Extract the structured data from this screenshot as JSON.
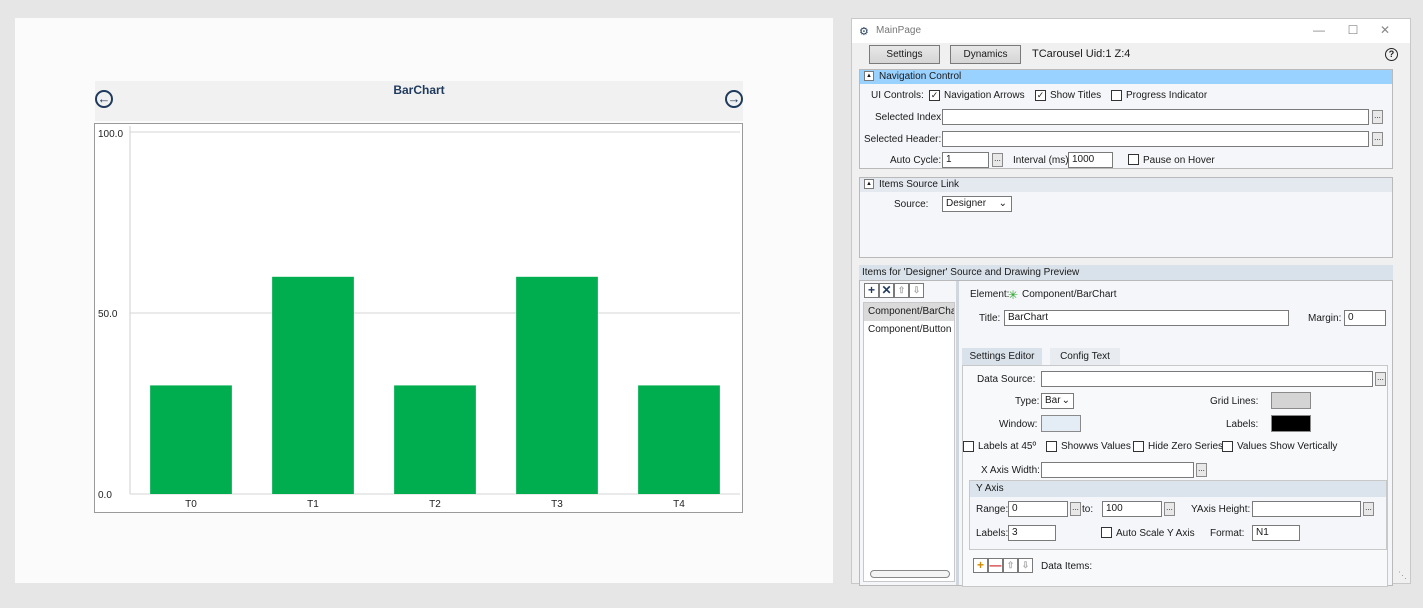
{
  "canvas": {
    "carousel_title": "BarChart",
    "prev_icon": "circle-arrow-left-icon",
    "next_icon": "circle-arrow-right-icon"
  },
  "chart_data": {
    "type": "bar",
    "categories": [
      "T0",
      "T1",
      "T2",
      "T3",
      "T4"
    ],
    "values": [
      30,
      60,
      30,
      60,
      30
    ],
    "ylim": [
      0,
      100
    ],
    "yticks": [
      "0.0",
      "50.0",
      "100.0"
    ],
    "grid": true,
    "bar_color": "#00ae4f",
    "title": "",
    "xlabel": "",
    "ylabel": ""
  },
  "window": {
    "title": "MainPage",
    "app_icon": "gear-icon",
    "minimize": "—",
    "maximize": "☐",
    "close": "✕",
    "tabs": [
      "Settings",
      "Dynamics"
    ],
    "component_info": "TCarousel Uid:1 Z:4",
    "help": "?"
  },
  "nav_control": {
    "header": "Navigation Control",
    "ui_controls_label": "UI Controls:",
    "nav_arrows_label": "Navigation Arrows",
    "nav_arrows_checked": true,
    "show_titles_label": "Show Titles",
    "show_titles_checked": true,
    "progress_label": "Progress Indicator",
    "progress_checked": false,
    "selected_index_label": "Selected Index:",
    "selected_index_value": "",
    "selected_header_label": "Selected Header:",
    "selected_header_value": "",
    "auto_cycle_label": "Auto Cycle:",
    "auto_cycle_value": "1",
    "interval_label": "Interval (ms)",
    "interval_value": "1000",
    "pause_label": "Pause on Hover",
    "pause_checked": false,
    "ellipsis": "..."
  },
  "items_source": {
    "header": "Items Source Link",
    "source_label": "Source:",
    "source_value": "Designer"
  },
  "items": {
    "header": "Items for 'Designer' Source and Drawing Preview",
    "toolbar": [
      "+",
      "✕",
      "⇧",
      "⇩"
    ],
    "list": [
      "Component/BarChart",
      "Component/Button"
    ],
    "selected_index": 0,
    "element_label": "Element:",
    "element_value": "Component/BarChart",
    "title_label": "Title:",
    "title_value": "BarChart",
    "margin_label": "Margin:",
    "margin_value": "0",
    "editor_tabs": [
      "Settings Editor",
      "Config Text"
    ],
    "data_source_label": "Data Source:",
    "data_source_value": "",
    "type_label": "Type:",
    "type_value": "Bar",
    "grid_lines_label": "Grid Lines:",
    "grid_lines_color": "#d4d4d4",
    "window_label": "Window:",
    "window_color": "#e4ecf5",
    "labels_color_label": "Labels:",
    "labels_color": "#000000",
    "labels45_label": "Labels at 45º",
    "show_values_label": "Showws Values",
    "hide_zero_label": "Hide Zero Series",
    "values_vert_label": "Values Show Vertically",
    "x_axis_width_label": "X Axis Width:",
    "x_axis_width_value": "",
    "y_axis": {
      "header": "Y Axis",
      "range_label": "Range:",
      "range_from": "0",
      "to_label": "to:",
      "range_to": "100",
      "height_label": "YAxis Height:",
      "height_value": "",
      "labels_label": "Labels:",
      "labels_value": "3",
      "auto_scale_label": "Auto Scale Y Axis",
      "format_label": "Format:",
      "format_value": "N1"
    },
    "data_items_label": "Data Items:"
  }
}
